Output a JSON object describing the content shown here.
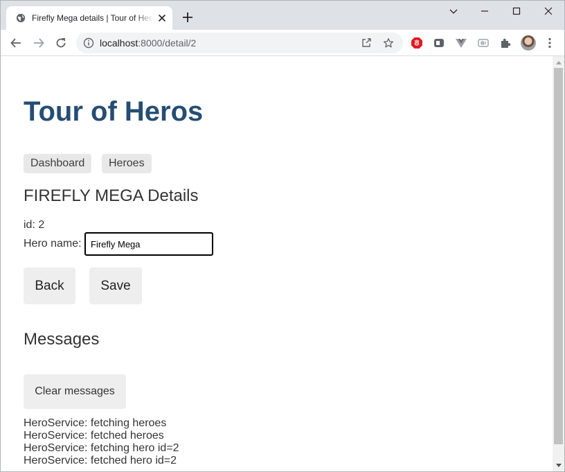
{
  "browser": {
    "tab_title": "Firefly Mega details | Tour of Heros",
    "url_host": "localhost",
    "url_path": ":8000/detail/2"
  },
  "page": {
    "app_title": "Tour of Heros",
    "nav": {
      "dashboard": "Dashboard",
      "heroes": "Heroes"
    },
    "details": {
      "heading": "FIREFLY MEGA Details",
      "id_label": "id: 2",
      "name_label": "Hero name:",
      "name_value": "Firefly Mega"
    },
    "buttons": {
      "back": "Back",
      "save": "Save",
      "clear_messages": "Clear messages"
    },
    "messages_heading": "Messages",
    "messages": [
      "HeroService: fetching heroes",
      "HeroService: fetched heroes",
      "HeroService: fetching hero id=2",
      "HeroService: fetched hero id=2"
    ]
  },
  "colors": {
    "title": "#264d73",
    "button_bg": "#eeeeee",
    "tabstrip_bg": "#dee1e6"
  },
  "icons": [
    "globe-icon",
    "close-icon",
    "plus-icon",
    "minimize-icon",
    "maximize-icon",
    "window-close-icon",
    "back-arrow-icon",
    "forward-arrow-icon",
    "reload-icon",
    "info-icon",
    "share-icon",
    "star-icon",
    "extension-icon",
    "puzzle-icon",
    "menu-dots-icon"
  ]
}
